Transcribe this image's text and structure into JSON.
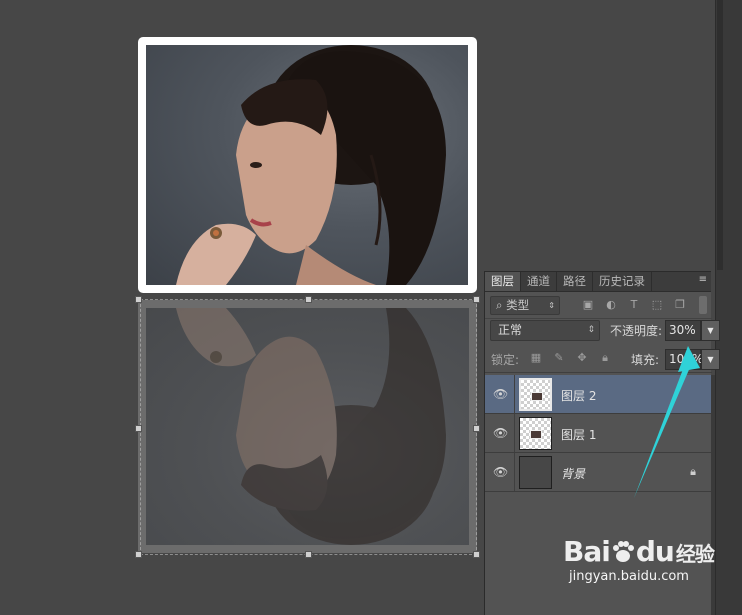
{
  "panel": {
    "tabs": [
      "图层",
      "通道",
      "路径",
      "历史记录"
    ],
    "menu_icon": "≡",
    "filter": {
      "label": "类型",
      "icons": [
        "image-filter-icon",
        "adjustment-filter-icon",
        "text-filter-icon",
        "shape-filter-icon",
        "smart-object-filter-icon"
      ]
    },
    "blend_mode": "正常",
    "opacity_label": "不透明度:",
    "opacity_value": "30%",
    "lock_label": "锁定:",
    "fill_label": "填充:",
    "fill_value": "100%",
    "layers": [
      {
        "name": "图层 2",
        "selected": true,
        "visible": true
      },
      {
        "name": "图层 1",
        "selected": false,
        "visible": true
      },
      {
        "name": "背景",
        "selected": false,
        "visible": true,
        "locked": true
      }
    ]
  },
  "watermark": {
    "logo_text": "Bai",
    "logo_text_2": "du",
    "logo_cn": "经验",
    "url": "jingyan.baidu.com"
  },
  "colors": {
    "canvas_bg": "#474747",
    "panel_bg": "#535353",
    "selected_layer": "#5a6a83",
    "annotation_arrow": "#2fd2d8"
  }
}
